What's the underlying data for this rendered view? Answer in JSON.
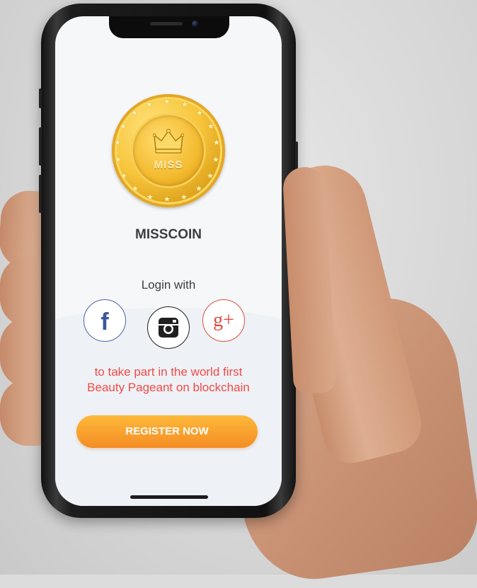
{
  "app": {
    "title": "MISSCOIN",
    "coin_text": "MISS"
  },
  "login": {
    "label": "Login with",
    "providers": [
      {
        "name": "Facebook",
        "icon": "facebook-icon",
        "glyph": "f",
        "color": "#3b5998"
      },
      {
        "name": "Instagram",
        "icon": "instagram-icon",
        "color": "#1f1f1f"
      },
      {
        "name": "Google Plus",
        "icon": "google-plus-icon",
        "glyph": "g+",
        "color": "#dc4e41"
      }
    ]
  },
  "tagline": {
    "line1": "to take part in the world first",
    "line2": "Beauty Pageant on blockchain"
  },
  "register": {
    "label": "REGISTER NOW"
  },
  "colors": {
    "accent": "#f58d25",
    "tagline": "#f04a47",
    "title": "#3d3d3d"
  }
}
